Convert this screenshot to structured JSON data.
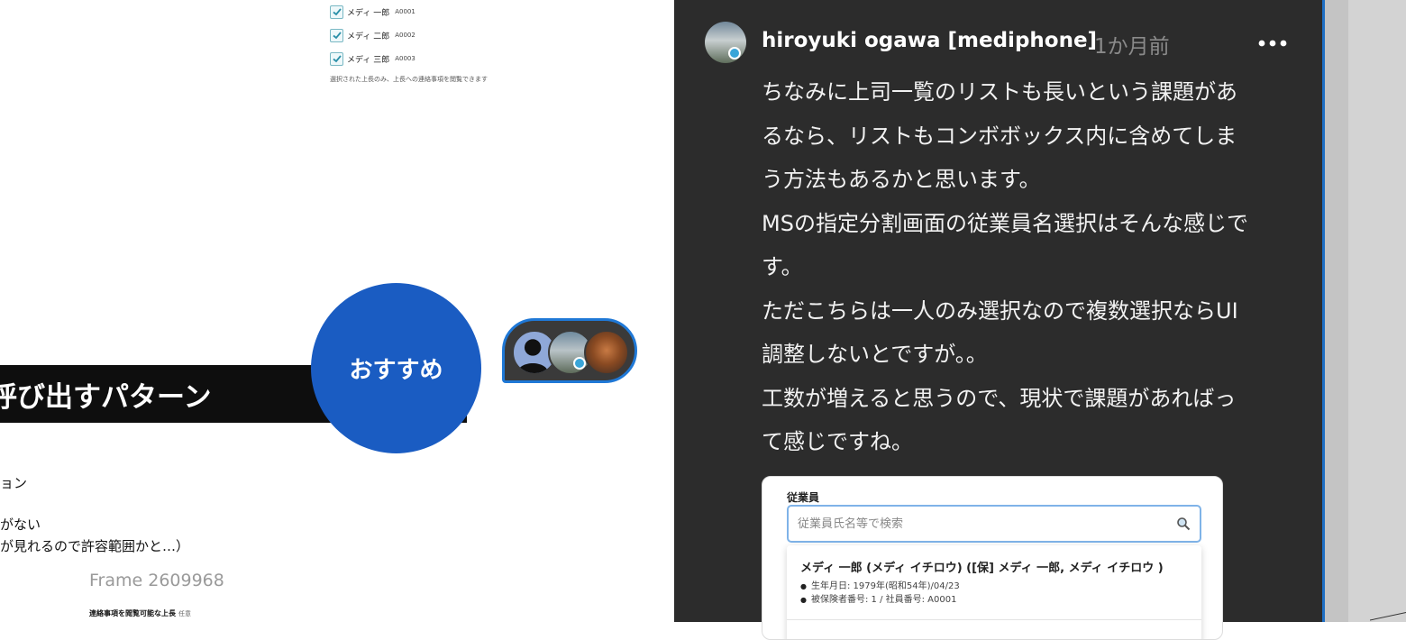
{
  "canvas": {
    "checkbox_items": [
      {
        "label": "メディ 一郎",
        "code": "A0001",
        "checked": true
      },
      {
        "label": "メディ 二郎",
        "code": "A0002",
        "checked": true
      },
      {
        "label": "メディ 三郎",
        "code": "A0003",
        "checked": true
      }
    ],
    "hint": "選択された上長のみ、上長への連絡事項を閲覧できます",
    "banner_text": "呼び出すパターン",
    "badge_text": "おすすめ",
    "left_lines": [
      "ョン",
      "がない",
      "が見れるので許容範囲かと…）"
    ],
    "frame_label": "Frame 2609968",
    "small_label": "連絡事項を閲覧可能な上長",
    "small_label_optional": "任意"
  },
  "comment": {
    "author": "hiroyuki ogawa [mediphone]",
    "time": "1か月前",
    "lines": [
      "ちなみに上司一覧のリストも長いという課題があ",
      "るなら、リストもコンボボックス内に含めてしま",
      "う方法もあるかと思います。",
      "MSの指定分割画面の従業員名選択はそんな感じで",
      "す。",
      "ただこちらは一人のみ選択なので複数選択ならUI",
      "調整しないとですが。。",
      "工数が増えると思うので、現状で課題があればっ",
      "て感じですね。"
    ]
  },
  "screenshot": {
    "field_label": "従業員",
    "search_placeholder": "従業員氏名等で検索",
    "result_name": "メディ 一郎 (メディ イチロウ) ([保] メディ 一郎, メディ イチロウ )",
    "result_birth": "生年月日: 1979年(昭和54年)/04/23",
    "result_ids": "被保険者番号: 1 / 社員番号: A0001"
  },
  "colors": {
    "badge_blue": "#1a5cc2",
    "panel_bg": "#2c2c2c",
    "selection_blue": "#1f78d6"
  }
}
